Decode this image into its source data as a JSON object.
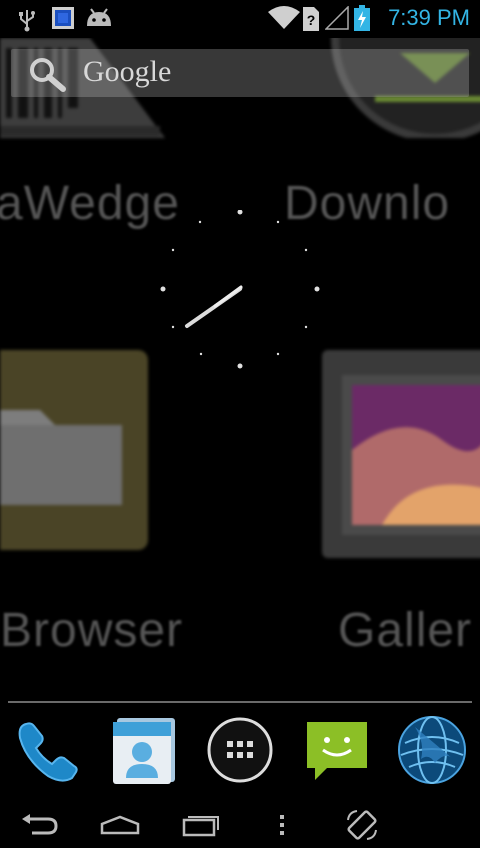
{
  "status_bar": {
    "time": "7:39 PM",
    "icons": [
      "usb-icon",
      "app-notification-icon",
      "android-debug-icon",
      "wifi-icon",
      "no-sim-icon",
      "signal-icon",
      "battery-charging-icon"
    ],
    "accent_color": "#33b5e5"
  },
  "search": {
    "placeholder": "Google"
  },
  "background_labels": {
    "top_left": "aWedge",
    "top_right": "Downlo",
    "bottom_left": "Browser",
    "bottom_right": "Galler"
  },
  "clock": {
    "type": "analog",
    "time": "7:39"
  },
  "dock": {
    "items": [
      "phone-icon",
      "contacts-icon",
      "all-apps-icon",
      "messaging-icon",
      "browser-icon"
    ]
  },
  "nav_bar": {
    "buttons": [
      "back-icon",
      "home-icon",
      "recent-apps-icon",
      "menu-icon",
      "rotate-icon"
    ]
  }
}
